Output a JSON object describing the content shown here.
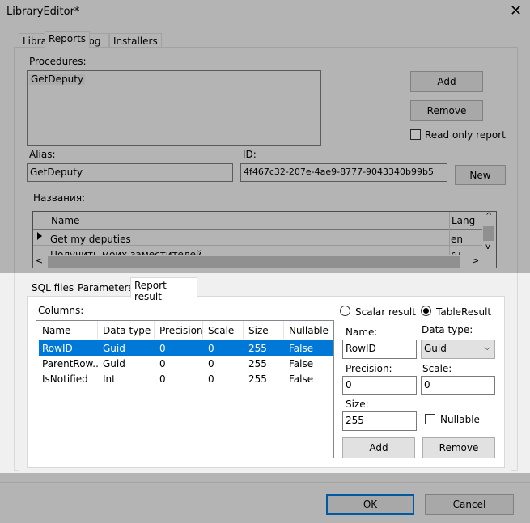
{
  "window": {
    "title": "LibraryEditor*",
    "close_icon": "close-icon"
  },
  "tabs": [
    {
      "label": "Library"
    },
    {
      "label": "Reports",
      "selected": true
    },
    {
      "label": "Log"
    },
    {
      "label": "Installers"
    }
  ],
  "reports": {
    "procedures_label": "Procedures:",
    "procedures": [
      "GetDeputy"
    ],
    "add_label": "Add",
    "remove_label": "Remove",
    "read_only_label": "Read only report",
    "read_only": false,
    "alias_label": "Alias:",
    "alias_value": "GetDeputy",
    "id_label": "ID:",
    "id_value": "4f467c32-207e-4ae9-8777-9043340b99b5",
    "new_label": "New",
    "names_label": "Названия:",
    "names_grid": {
      "columns": [
        "Name",
        "Lang"
      ],
      "rows": [
        [
          "Get my deputies",
          "en"
        ],
        [
          "Получить моих заместителей",
          "ru"
        ]
      ]
    }
  },
  "inner_tabs": [
    {
      "label": "SQL files"
    },
    {
      "label": "Parameters"
    },
    {
      "label": "Report result",
      "selected": true
    }
  ],
  "report_result": {
    "columns_label": "Columns:",
    "headers": [
      "Name",
      "Data type",
      "Precision",
      "Scale",
      "Size",
      "Nullable"
    ],
    "rows": [
      [
        "RowID",
        "Guid",
        "0",
        "0",
        "255",
        "False"
      ],
      [
        "ParentRow...",
        "Guid",
        "0",
        "0",
        "255",
        "False"
      ],
      [
        "IsNotified",
        "Int",
        "0",
        "0",
        "255",
        "False"
      ]
    ],
    "selected_row": 0,
    "scalar_label": "Scalar result",
    "table_label": "TableResult",
    "result_mode": "TableResult",
    "name_label": "Name:",
    "name_value": "RowID",
    "datatype_label": "Data type:",
    "datatype_value": "Guid",
    "precision_label": "Precision:",
    "precision_value": "0",
    "scale_label": "Scale:",
    "scale_value": "0",
    "size_label": "Size:",
    "size_value": "255",
    "nullable_label": "Nullable",
    "nullable": false,
    "add_label": "Add",
    "remove_label": "Remove"
  },
  "footer": {
    "ok_label": "OK",
    "cancel_label": "Cancel"
  },
  "colors": {
    "selection": "#0078d7",
    "dialog_bg": "#f0f0f0"
  }
}
